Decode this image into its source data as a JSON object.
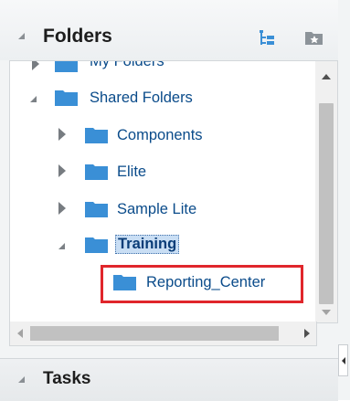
{
  "folders_panel": {
    "title": "Folders",
    "header_icons": [
      "tree-view-icon",
      "favorite-folder-icon"
    ]
  },
  "tree": {
    "partial_item": {
      "label": "My Folders"
    },
    "shared": {
      "label": "Shared Folders",
      "expanded": true
    },
    "children": [
      {
        "label": "Components",
        "expanded": false
      },
      {
        "label": "Elite",
        "expanded": false
      },
      {
        "label": "Sample Lite",
        "expanded": false
      },
      {
        "label": "Training",
        "expanded": true,
        "selected": true
      }
    ],
    "grandchild": {
      "label": "Reporting_Center"
    }
  },
  "tasks_panel": {
    "title": "Tasks"
  },
  "colors": {
    "folder": "#3a8fd6",
    "link_text": "#0a4b8a",
    "highlight_border": "#e0262b",
    "selection_bg": "#c9def4"
  }
}
